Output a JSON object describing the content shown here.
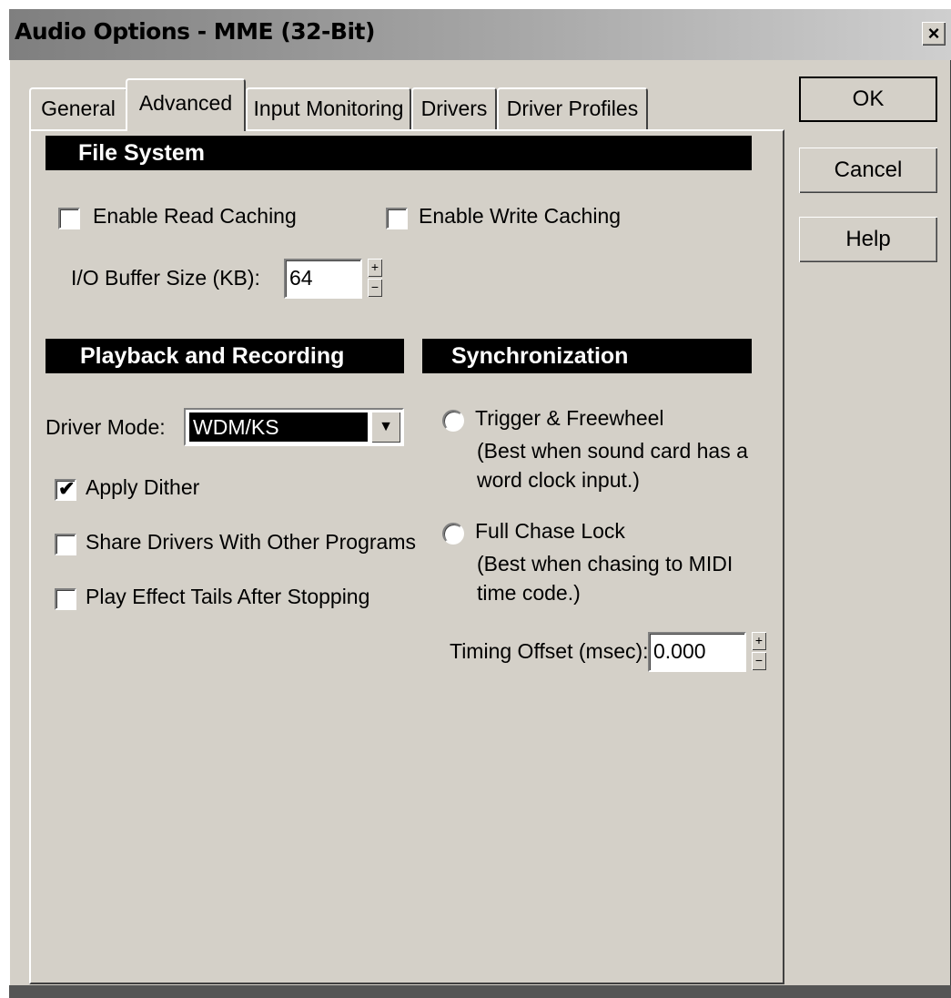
{
  "window": {
    "title": "Audio Options - MME (32-Bit)",
    "close_label": "×"
  },
  "tabs": [
    {
      "label": "General",
      "active": false
    },
    {
      "label": "Advanced",
      "active": true
    },
    {
      "label": "Input Monitoring",
      "active": false
    },
    {
      "label": "Drivers",
      "active": false
    },
    {
      "label": "Driver Profiles",
      "active": false
    }
  ],
  "buttons": {
    "ok": "OK",
    "cancel": "Cancel",
    "help": "Help"
  },
  "file_system": {
    "header": "File System",
    "read_caching": {
      "label": "Enable Read Caching",
      "checked": false
    },
    "write_caching": {
      "label": "Enable Write Caching",
      "checked": false
    },
    "buffer": {
      "label": "I/O Buffer Size (KB):",
      "value": "64"
    }
  },
  "playback": {
    "header": "Playback and Recording",
    "driver_mode": {
      "label": "Driver Mode:",
      "value": "WDM/KS"
    },
    "apply_dither": {
      "label": "Apply Dither",
      "checked": true
    },
    "share_drivers": {
      "label": "Share Drivers With Other Programs",
      "checked": false
    },
    "effect_tails": {
      "label": "Play Effect Tails After Stopping",
      "checked": false
    }
  },
  "sync": {
    "header": "Synchronization",
    "trigger": {
      "label": "Trigger & Freewheel",
      "desc1": "(Best when sound card has a",
      "desc2": "word clock input.)",
      "selected": false
    },
    "chase": {
      "label": "Full Chase Lock",
      "desc1": "(Best when chasing to MIDI",
      "desc2": "time code.)",
      "selected": false
    },
    "timing_offset": {
      "label": "Timing Offset (msec):",
      "value": "0.000"
    }
  },
  "icons": {
    "spinner_up": "+",
    "spinner_down": "−",
    "dropdown_arrow": "▼",
    "check": "✔"
  }
}
